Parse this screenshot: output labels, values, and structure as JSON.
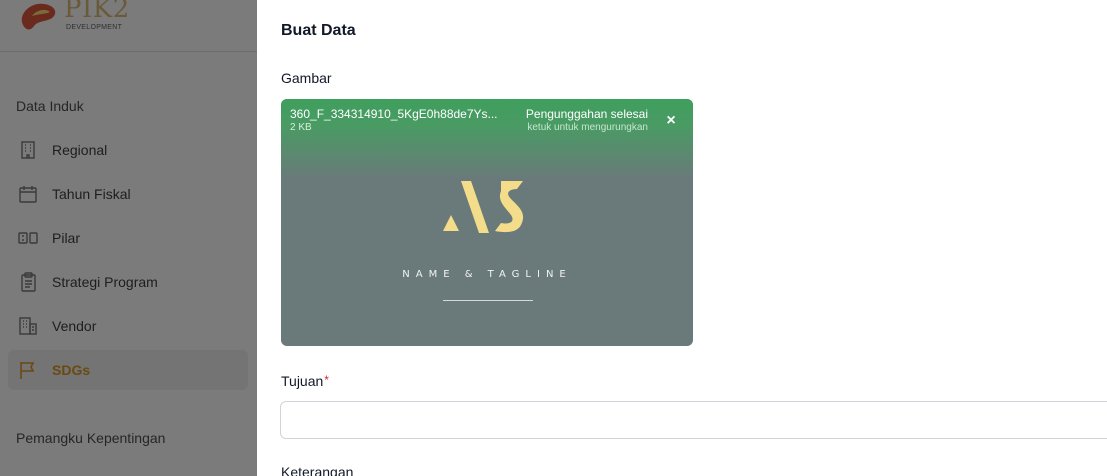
{
  "logo": {
    "text": "PIK2",
    "subtext": "DEVELOPMENT"
  },
  "sidebar": {
    "sections": [
      {
        "title": "Data Induk"
      },
      {
        "title": "Pemangku Kepentingan"
      }
    ],
    "items": [
      {
        "label": "Regional",
        "icon": "building-icon"
      },
      {
        "label": "Tahun Fiskal",
        "icon": "calendar-icon"
      },
      {
        "label": "Pilar",
        "icon": "pillar-icon"
      },
      {
        "label": "Strategi Program",
        "icon": "clipboard-icon"
      },
      {
        "label": "Vendor",
        "icon": "vendor-building-icon"
      },
      {
        "label": "SDGs",
        "icon": "flag-icon",
        "active": true
      }
    ]
  },
  "drawer": {
    "title": "Buat Data",
    "image_field": {
      "label": "Gambar",
      "file_name": "360_F_334314910_5KgE0h88de7Ys...",
      "file_size": "2 KB",
      "status": "Pengunggahan selesai",
      "status_hint": "ketuk untuk mengurungkan",
      "preview_tagline": "NAME & TAGLINE"
    },
    "tujuan_field": {
      "label": "Tujuan",
      "required_mark": "*",
      "value": ""
    },
    "keterangan_field": {
      "label": "Keterangan"
    }
  },
  "colors": {
    "active_nav": "#6a4a10",
    "upload_success": "#3f9f5d",
    "preview_bg": "#6a7a7a",
    "preview_logo": "#f3dc8a",
    "required": "#dc2626"
  }
}
